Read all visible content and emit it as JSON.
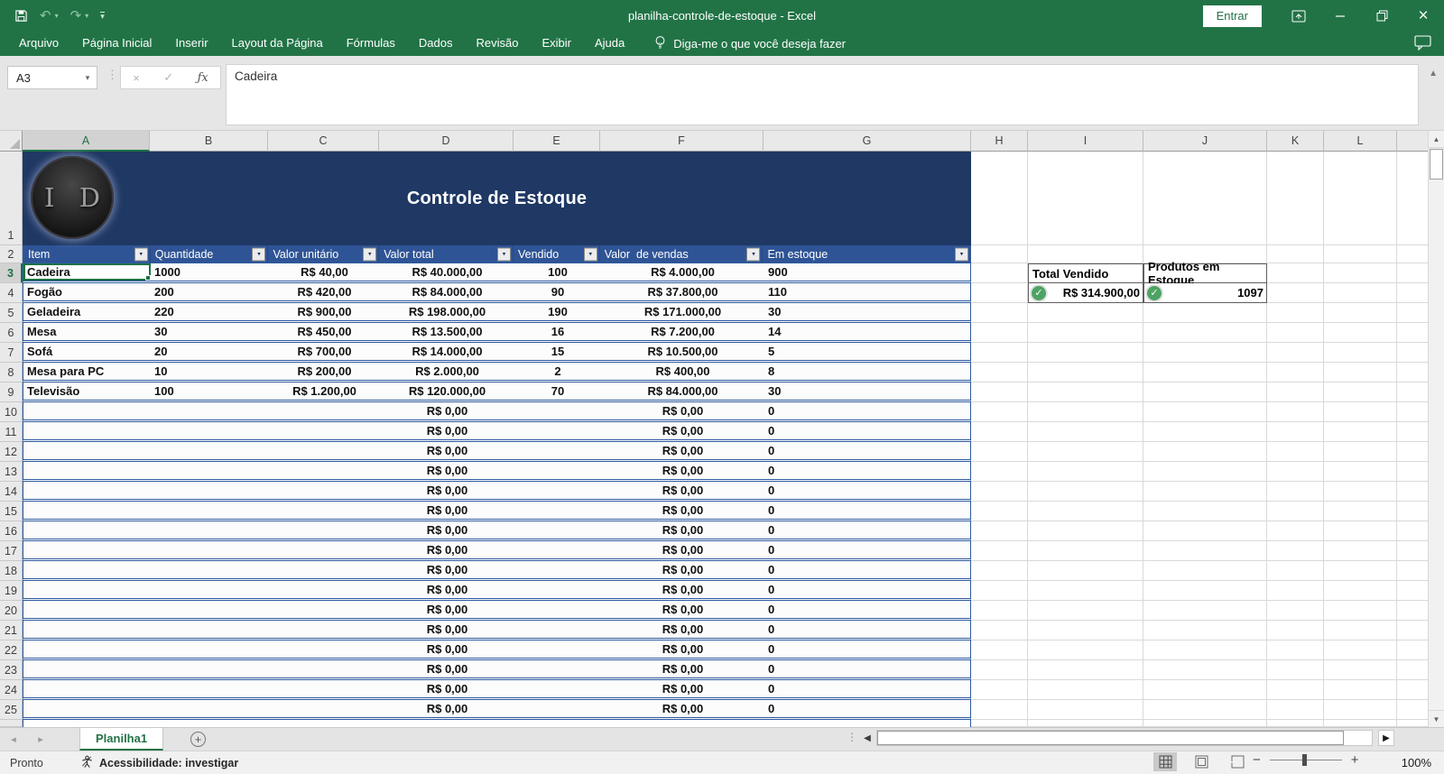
{
  "window": {
    "title": "planilha-controle-de-estoque  -  Excel",
    "sign_in": "Entrar"
  },
  "ribbon": {
    "tabs": [
      "Arquivo",
      "Página Inicial",
      "Inserir",
      "Layout da Página",
      "Fórmulas",
      "Dados",
      "Revisão",
      "Exibir",
      "Ajuda"
    ],
    "tell_me": "Diga-me o que você deseja fazer"
  },
  "formula_bar": {
    "name_box": "A3",
    "content": "Cadeira"
  },
  "sheet": {
    "column_labels": [
      "A",
      "B",
      "C",
      "D",
      "E",
      "F",
      "G",
      "H",
      "I",
      "J",
      "K",
      "L"
    ],
    "banner": {
      "logo_text": "I D",
      "title": "Controle de Estoque"
    },
    "table": {
      "headers": [
        "Item",
        "Quantidade",
        "Valor unitário",
        "Valor total",
        "Vendido",
        "Valor  de vendas",
        "Em estoque"
      ],
      "rows": [
        {
          "n": 3,
          "cells": [
            "Cadeira",
            "1000",
            "R$ 40,00",
            "R$ 40.000,00",
            "100",
            "R$ 4.000,00",
            "900"
          ]
        },
        {
          "n": 4,
          "cells": [
            "Fogão",
            "200",
            "R$ 420,00",
            "R$ 84.000,00",
            "90",
            "R$ 37.800,00",
            "110"
          ]
        },
        {
          "n": 5,
          "cells": [
            "Geladeira",
            "220",
            "R$ 900,00",
            "R$ 198.000,00",
            "190",
            "R$ 171.000,00",
            "30"
          ]
        },
        {
          "n": 6,
          "cells": [
            "Mesa",
            "30",
            "R$ 450,00",
            "R$ 13.500,00",
            "16",
            "R$ 7.200,00",
            "14"
          ]
        },
        {
          "n": 7,
          "cells": [
            "Sofá",
            "20",
            "R$ 700,00",
            "R$ 14.000,00",
            "15",
            "R$ 10.500,00",
            "5"
          ]
        },
        {
          "n": 8,
          "cells": [
            "Mesa para PC",
            "10",
            "R$ 200,00",
            "R$ 2.000,00",
            "2",
            "R$ 400,00",
            "8"
          ]
        },
        {
          "n": 9,
          "cells": [
            "Televisão",
            "100",
            "R$ 1.200,00",
            "R$ 120.000,00",
            "70",
            "R$ 84.000,00",
            "30"
          ]
        }
      ],
      "empty_row_cells": [
        "",
        "",
        "",
        "R$ 0,00",
        "",
        "R$ 0,00",
        "0"
      ],
      "empty_rows": {
        "from": 10,
        "to": 25
      }
    },
    "summary": {
      "headers": [
        "Total Vendido",
        "Produtos em Estoque"
      ],
      "values": [
        "R$ 314.900,00",
        "1097"
      ]
    },
    "selection": {
      "cell_ref": "A3"
    }
  },
  "sheet_tabs": {
    "active": "Planilha1"
  },
  "status_bar": {
    "mode": "Pronto",
    "accessibility": "Acessibilidade: investigar",
    "zoom_level": "100%"
  },
  "icons": {
    "qat": [
      "save-icon",
      "undo-icon",
      "redo-icon",
      "customize-qat-icon"
    ],
    "titlebar": [
      "ribbon-display-options-icon",
      "minimize-icon",
      "restore-icon",
      "close-icon"
    ],
    "ribbon": [
      "lightbulb-icon",
      "comment-icon"
    ],
    "status": [
      "accessibility-icon",
      "normal-view-icon",
      "page-layout-icon",
      "page-break-icon"
    ]
  },
  "colors": {
    "excel_green": "#217346",
    "banner_blue": "#1f3864",
    "table_header_blue": "#2f5496",
    "row_border_blue": "#2d5aa0",
    "check_green": "#4ea364"
  }
}
